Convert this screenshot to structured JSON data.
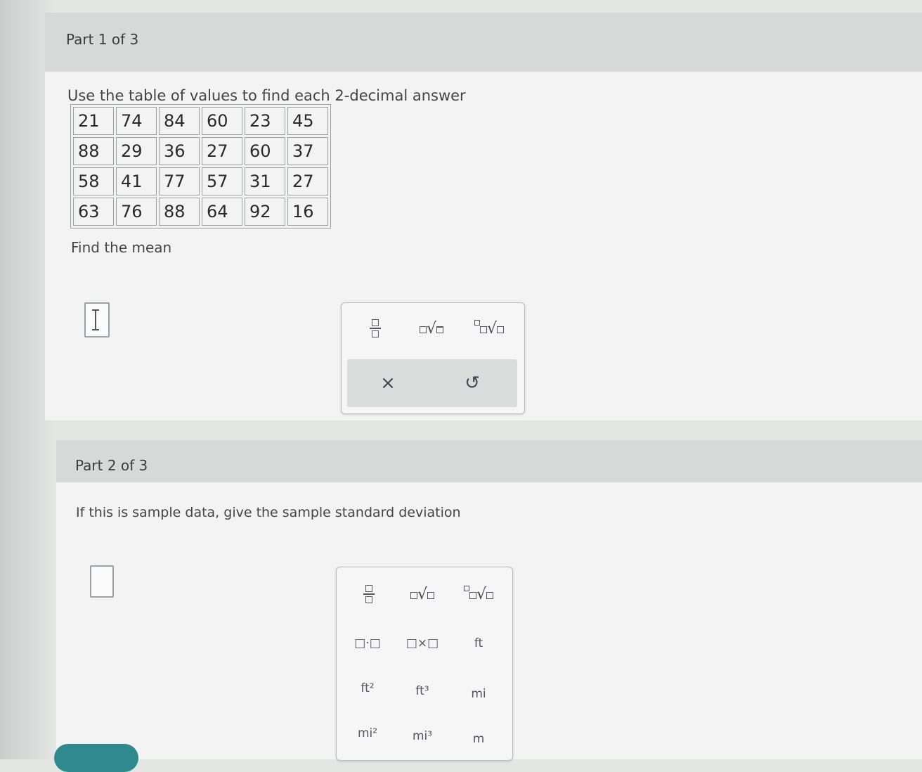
{
  "part1": {
    "header": "Part 1 of 3",
    "instruction": "Use the table of values to find each 2-decimal answer",
    "table": [
      [
        "21",
        "74",
        "84",
        "60",
        "23",
        "45"
      ],
      [
        "88",
        "29",
        "36",
        "27",
        "60",
        "37"
      ],
      [
        "58",
        "41",
        "77",
        "57",
        "31",
        "27"
      ],
      [
        "63",
        "76",
        "88",
        "64",
        "92",
        "16"
      ]
    ],
    "question": "Find the mean",
    "toolbar": {
      "buttons": [
        "fraction-icon",
        "sqrt-icon",
        "nth-root-icon"
      ],
      "clear": "×",
      "undo": "↺"
    }
  },
  "part2": {
    "header": "Part 2 of 3",
    "question": "If this is sample data, give the sample standard deviation",
    "toolbar": {
      "row1": [
        "fraction-icon",
        "sqrt-icon",
        "nth-root-icon"
      ],
      "row2_units": [
        "□·□",
        "□×□",
        "ft"
      ],
      "row3_units": [
        "ft²",
        "ft³",
        "mi"
      ],
      "row4_units": [
        "mi²",
        "mi³",
        "m"
      ]
    }
  }
}
